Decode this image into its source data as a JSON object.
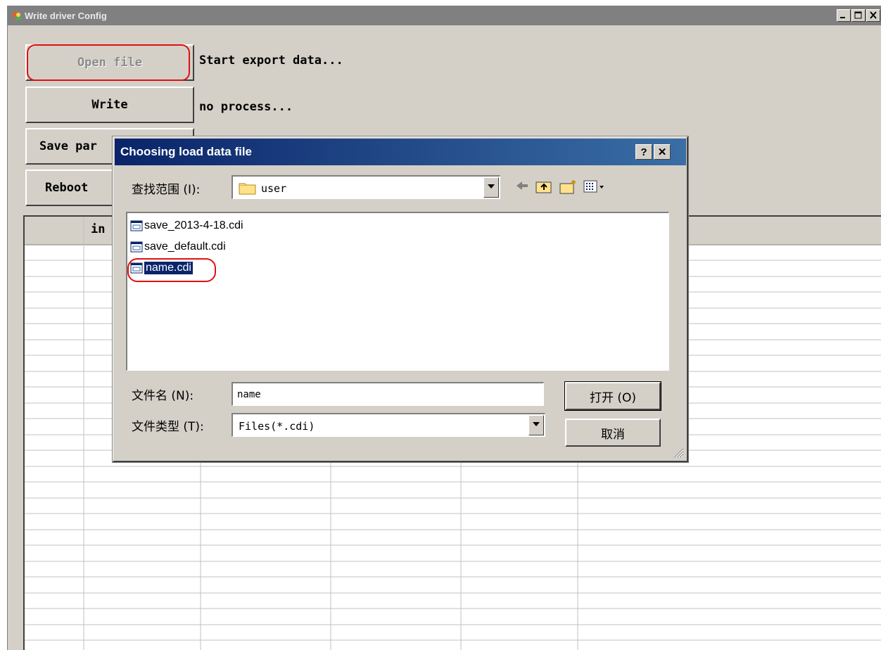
{
  "window": {
    "title": "Write driver Config"
  },
  "buttons": {
    "open_file": "Open file",
    "write": "Write",
    "save_params": "Save par",
    "reboot": "Reboot"
  },
  "status": {
    "line1": "Start export data...",
    "line2": "no process..."
  },
  "grid": {
    "col2_header": "in"
  },
  "dialog": {
    "title": "Choosing load data file",
    "help_label": "?",
    "close_label": "✕",
    "look_in_label": "查找范围 (I):",
    "look_in_value": "user",
    "files": [
      {
        "name": "save_2013-4-18.cdi",
        "selected": false
      },
      {
        "name": "save_default.cdi",
        "selected": false
      },
      {
        "name": "name.cdi",
        "selected": true
      }
    ],
    "filename_label": "文件名 (N):",
    "filename_value": "name",
    "filetype_label": "文件类型 (T):",
    "filetype_value": "Files(*.cdi)",
    "open_button": "打开 (O)",
    "cancel_button": "取消"
  },
  "colors": {
    "highlight_ring": "#e01010",
    "title_active": "#0a246a",
    "title_inactive": "#808080",
    "face": "#d4d0c8"
  },
  "icons": {
    "back": "back-arrow-icon",
    "up": "up-folder-icon",
    "new_folder": "new-folder-icon",
    "view_menu": "view-menu-icon"
  }
}
